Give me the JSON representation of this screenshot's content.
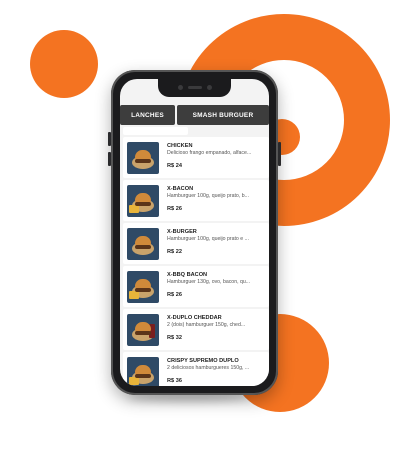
{
  "colors": {
    "accent": "#f47321",
    "tab_bg": "#3d3d3d",
    "phone_frame": "#1b1b1d"
  },
  "tabs": [
    {
      "label": "LANCHES"
    },
    {
      "label": "SMASH BURGUER"
    }
  ],
  "menu": {
    "items": [
      {
        "name": "CHICKEN",
        "description": "Delicioso frango empanado, alface...",
        "price": "R$ 24"
      },
      {
        "name": "X-BACON",
        "description": "Hamburguer 100g, queijo prato, b...",
        "price": "R$ 26"
      },
      {
        "name": "X-BURGER",
        "description": "Hamburguer 100g, queijo prato e ...",
        "price": "R$ 22"
      },
      {
        "name": "X-BBQ BACON",
        "description": "Hamburguer 130g, ovo, bacon, qu...",
        "price": "R$ 26"
      },
      {
        "name": "X-DUPLO CHEDDAR",
        "description": "2 (dois) hamburguer 150g, ched...",
        "price": "R$ 32"
      },
      {
        "name": "CRISPY SUPREMO DUPLO",
        "description": "2 deliciosos hamburgueres 150g, ...",
        "price": "R$ 36"
      }
    ]
  }
}
